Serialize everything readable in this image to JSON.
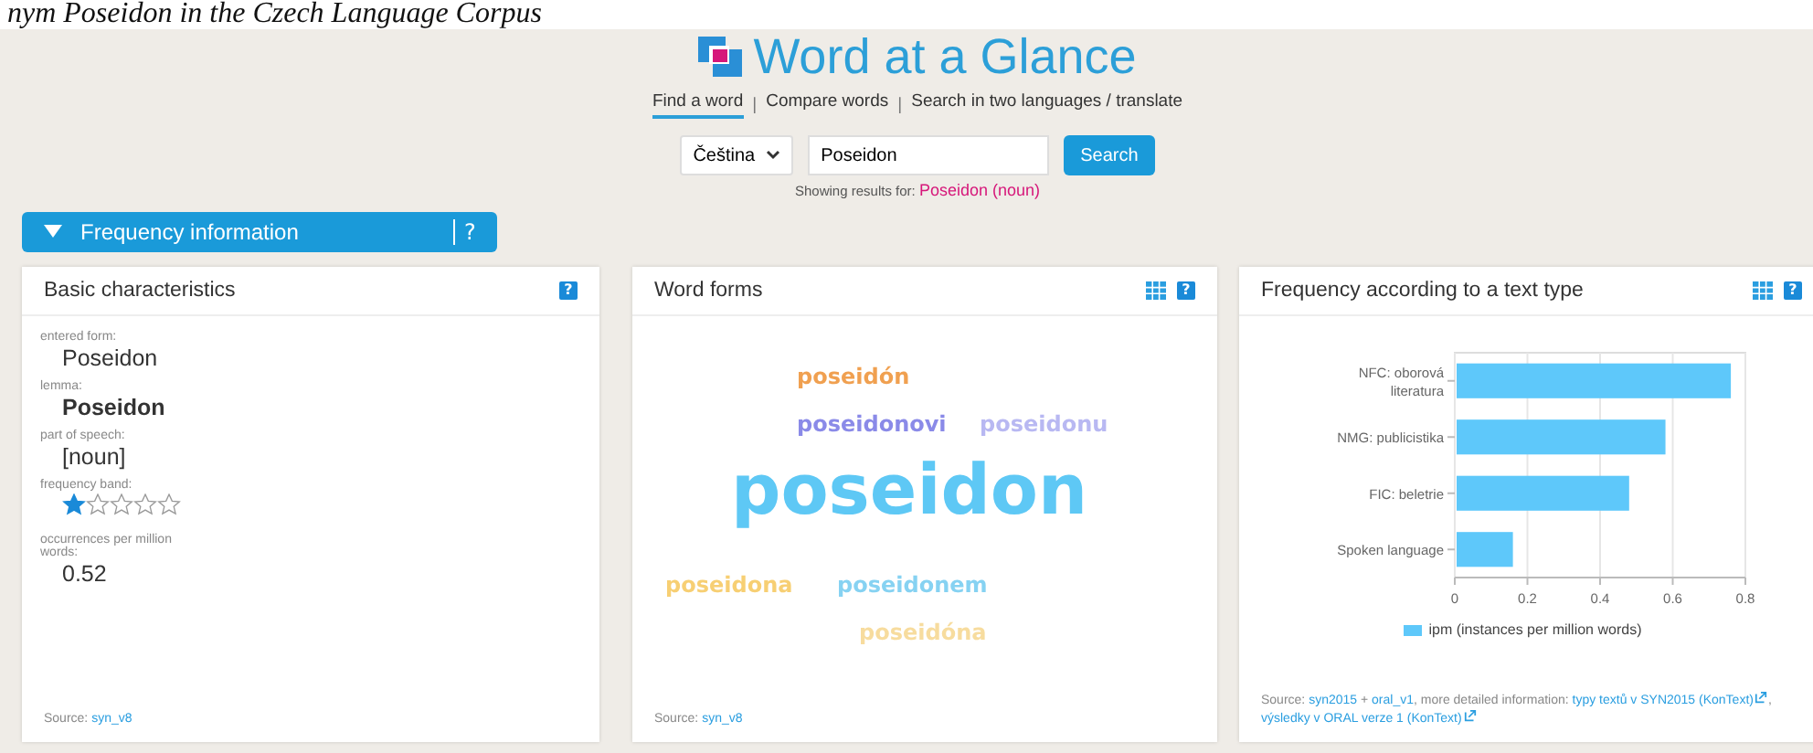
{
  "caption": "nym Poseidon in the Czech Language Corpus",
  "logo": {
    "title": "Word at a Glance"
  },
  "nav": [
    {
      "label": "Find a word",
      "selected": true
    },
    {
      "label": "Compare words",
      "selected": false
    },
    {
      "label": "Search in two languages / translate",
      "selected": false
    }
  ],
  "nav_separators": [
    "|",
    "|"
  ],
  "search": {
    "language": "Čeština",
    "value": "Poseidon",
    "button": "Search",
    "results_prefix": "Showing results for:",
    "results_link": "Poseidon (noun)"
  },
  "section": {
    "title": "Frequency information",
    "expanded": true,
    "help": "?"
  },
  "cards": [
    {
      "kind": "basic",
      "title": "Basic characteristics",
      "help": "?",
      "table_icon": false,
      "fields": [
        {
          "label": "entered form:",
          "value": "Poseidon",
          "bold": false
        },
        {
          "label": "lemma:",
          "value": "Poseidon",
          "bold": true
        },
        {
          "label": "part of speech:",
          "value": "[noun]",
          "bold": false
        }
      ],
      "frequency_band": {
        "label": "frequency band:",
        "stars": 1
      },
      "occurrences": {
        "label": "occurrences per million words:",
        "value": "0.52"
      },
      "source": [
        {
          "text": "Source: ",
          "link": false,
          "external": false
        },
        {
          "text": "syn_v8",
          "link": true,
          "external": false
        }
      ]
    },
    {
      "kind": "wordcloud",
      "title": "Word forms",
      "help": "?",
      "table_icon": true,
      "words": [
        {
          "text": "poseidón",
          "color": "#f0a050",
          "kind": "minor"
        },
        {
          "text": "poseidonovi",
          "color": "#8a8ae8",
          "kind": "minor"
        },
        {
          "text": "poseidonu",
          "color": "#b8b8f2",
          "kind": "minor"
        },
        {
          "text": "poseidon",
          "color": "#5ec8f5",
          "kind": "main"
        },
        {
          "text": "poseidona",
          "color": "#f7cf73",
          "kind": "minor"
        },
        {
          "text": "poseidonem",
          "color": "#86d2f2",
          "kind": "minor"
        },
        {
          "text": "poseidóna",
          "color": "#f7dc9e",
          "kind": "minor"
        }
      ],
      "source": [
        {
          "text": "Source: ",
          "link": false,
          "external": false
        },
        {
          "text": "syn_v8",
          "link": true,
          "external": false
        }
      ]
    },
    {
      "kind": "chart",
      "title": "Frequency according to a text type",
      "help": "?",
      "table_icon": true,
      "chart_data": {
        "type": "bar",
        "orientation": "horizontal",
        "categories": [
          "NFC: oborová literatura",
          "NMG: publicistika",
          "FIC: beletrie",
          "Spoken language"
        ],
        "series": [
          {
            "name": "ipm (instances per million words)",
            "color": "#5ec8fa",
            "values": [
              0.76,
              0.58,
              0.48,
              0.16
            ]
          }
        ],
        "xlim": [
          0,
          0.8
        ],
        "xticks": [
          0,
          0.2,
          0.4,
          0.6,
          0.8
        ],
        "grid": true
      },
      "source": [
        {
          "text": "Source: ",
          "link": false,
          "external": false
        },
        {
          "text": "syn2015",
          "link": true,
          "external": false
        },
        {
          "text": " + ",
          "link": false,
          "external": false
        },
        {
          "text": "oral_v1",
          "link": true,
          "external": false
        },
        {
          "text": ", more detailed information: ",
          "link": false,
          "external": false
        },
        {
          "text": "typy textů v SYN2015 (KonText)",
          "link": true,
          "external": true
        },
        {
          "text": ", ",
          "link": false,
          "external": false
        },
        {
          "text": "výsledky v ORAL verze 1 (KonText)",
          "link": true,
          "external": true
        }
      ]
    }
  ]
}
